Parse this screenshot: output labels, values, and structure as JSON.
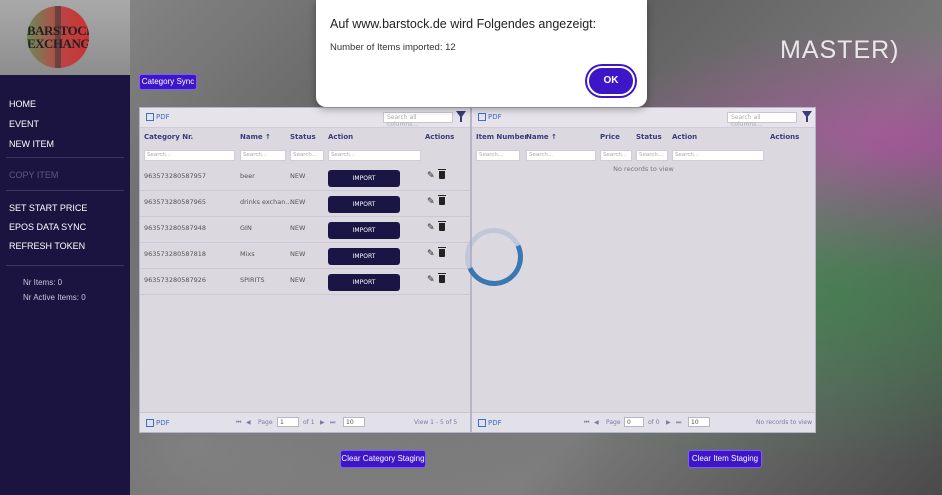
{
  "header": {
    "title_partial": "MASTER)"
  },
  "logo": {
    "line1": "BARSTOCK",
    "line2": "EXCHANGE"
  },
  "sidebar": {
    "items": [
      {
        "label": "HOME"
      },
      {
        "label": "EVENT"
      },
      {
        "label": "NEW ITEM"
      },
      {
        "label": "COPY ITEM"
      },
      {
        "label": "SET START PRICE"
      },
      {
        "label": "EPOS DATA SYNC"
      },
      {
        "label": "REFRESH TOKEN"
      }
    ],
    "nr_items": "Nr Items: 0",
    "nr_active_items": "Nr Active Items: 0"
  },
  "category_sync_label": "Category Sync",
  "left_grid": {
    "pdf_label": "PDF",
    "search_placeholder": "Search all columns...",
    "columns": [
      "Category Nr.",
      "Name ↑",
      "Status",
      "Action",
      "Actions"
    ],
    "filter_placeholders": [
      "Search...",
      "Search...",
      "Search...",
      "Search..."
    ],
    "rows": [
      {
        "nr": "9635732805879​57",
        "name": "beer",
        "status": "NEW",
        "action": "IMPORT"
      },
      {
        "nr": "963573280587965",
        "name": "drinks exchan...",
        "status": "NEW",
        "action": "IMPORT"
      },
      {
        "nr": "963573280587948",
        "name": "GIN",
        "status": "NEW",
        "action": "IMPORT"
      },
      {
        "nr": "963573280587818",
        "name": "Mixs",
        "status": "NEW",
        "action": "IMPORT"
      },
      {
        "nr": "963573280587926",
        "name": "SPIRITS",
        "status": "NEW",
        "action": "IMPORT"
      }
    ],
    "pager": {
      "page_label": "Page",
      "page_value": "1",
      "of_label": "of 1",
      "size": "10",
      "view": "View 1 - 5 of 5"
    }
  },
  "right_grid": {
    "pdf_label": "PDF",
    "search_placeholder": "Search all columns...",
    "columns": [
      "Item Number",
      "Name ↑",
      "Price",
      "Status",
      "Action",
      "Actions"
    ],
    "filter_placeholders": [
      "Search...",
      "Search...",
      "Search...",
      "Search...",
      "Search..."
    ],
    "no_records": "No records to view",
    "pager": {
      "page_label": "Page",
      "page_value": "0",
      "of_label": "of 0",
      "size": "10",
      "view": "No records to view"
    }
  },
  "clear_category_label": "Clear Category Staging",
  "clear_item_label": "Clear Item Staging",
  "dialog": {
    "title": "Auf www.barstock.de wird Folgendes angezeigt:",
    "message": "Number of Items imported: 12",
    "ok_label": "OK"
  }
}
